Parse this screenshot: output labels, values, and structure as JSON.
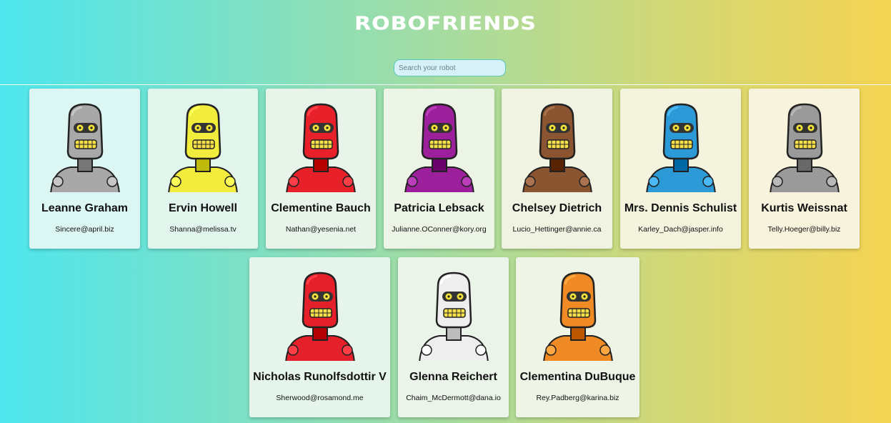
{
  "app": {
    "title": "ROBOFRIENDS"
  },
  "search": {
    "placeholder": "Search your robot",
    "value": ""
  },
  "robots": [
    {
      "name": "Leanne Graham",
      "email": "Sincere@april.biz",
      "color": "#a8a8a8"
    },
    {
      "name": "Ervin Howell",
      "email": "Shanna@melissa.tv",
      "color": "#f2ec3c"
    },
    {
      "name": "Clementine Bauch",
      "email": "Nathan@yesenia.net",
      "color": "#e8202a"
    },
    {
      "name": "Patricia Lebsack",
      "email": "Julianne.OConner@kory.org",
      "color": "#9c1f9c"
    },
    {
      "name": "Chelsey Dietrich",
      "email": "Lucio_Hettinger@annie.ca",
      "color": "#8a5530"
    },
    {
      "name": "Mrs. Dennis Schulist",
      "email": "Karley_Dach@jasper.info",
      "color": "#2c9ad6"
    },
    {
      "name": "Kurtis Weissnat",
      "email": "Telly.Hoeger@billy.biz",
      "color": "#9a9a9a"
    },
    {
      "name": "Nicholas Runolfsdottir V",
      "email": "Sherwood@rosamond.me",
      "color": "#e6202a"
    },
    {
      "name": "Glenna Reichert",
      "email": "Chaim_McDermott@dana.io",
      "color": "#eeeeee"
    },
    {
      "name": "Clementina DuBuque",
      "email": "Rey.Padberg@karina.biz",
      "color": "#f08a24"
    }
  ]
}
